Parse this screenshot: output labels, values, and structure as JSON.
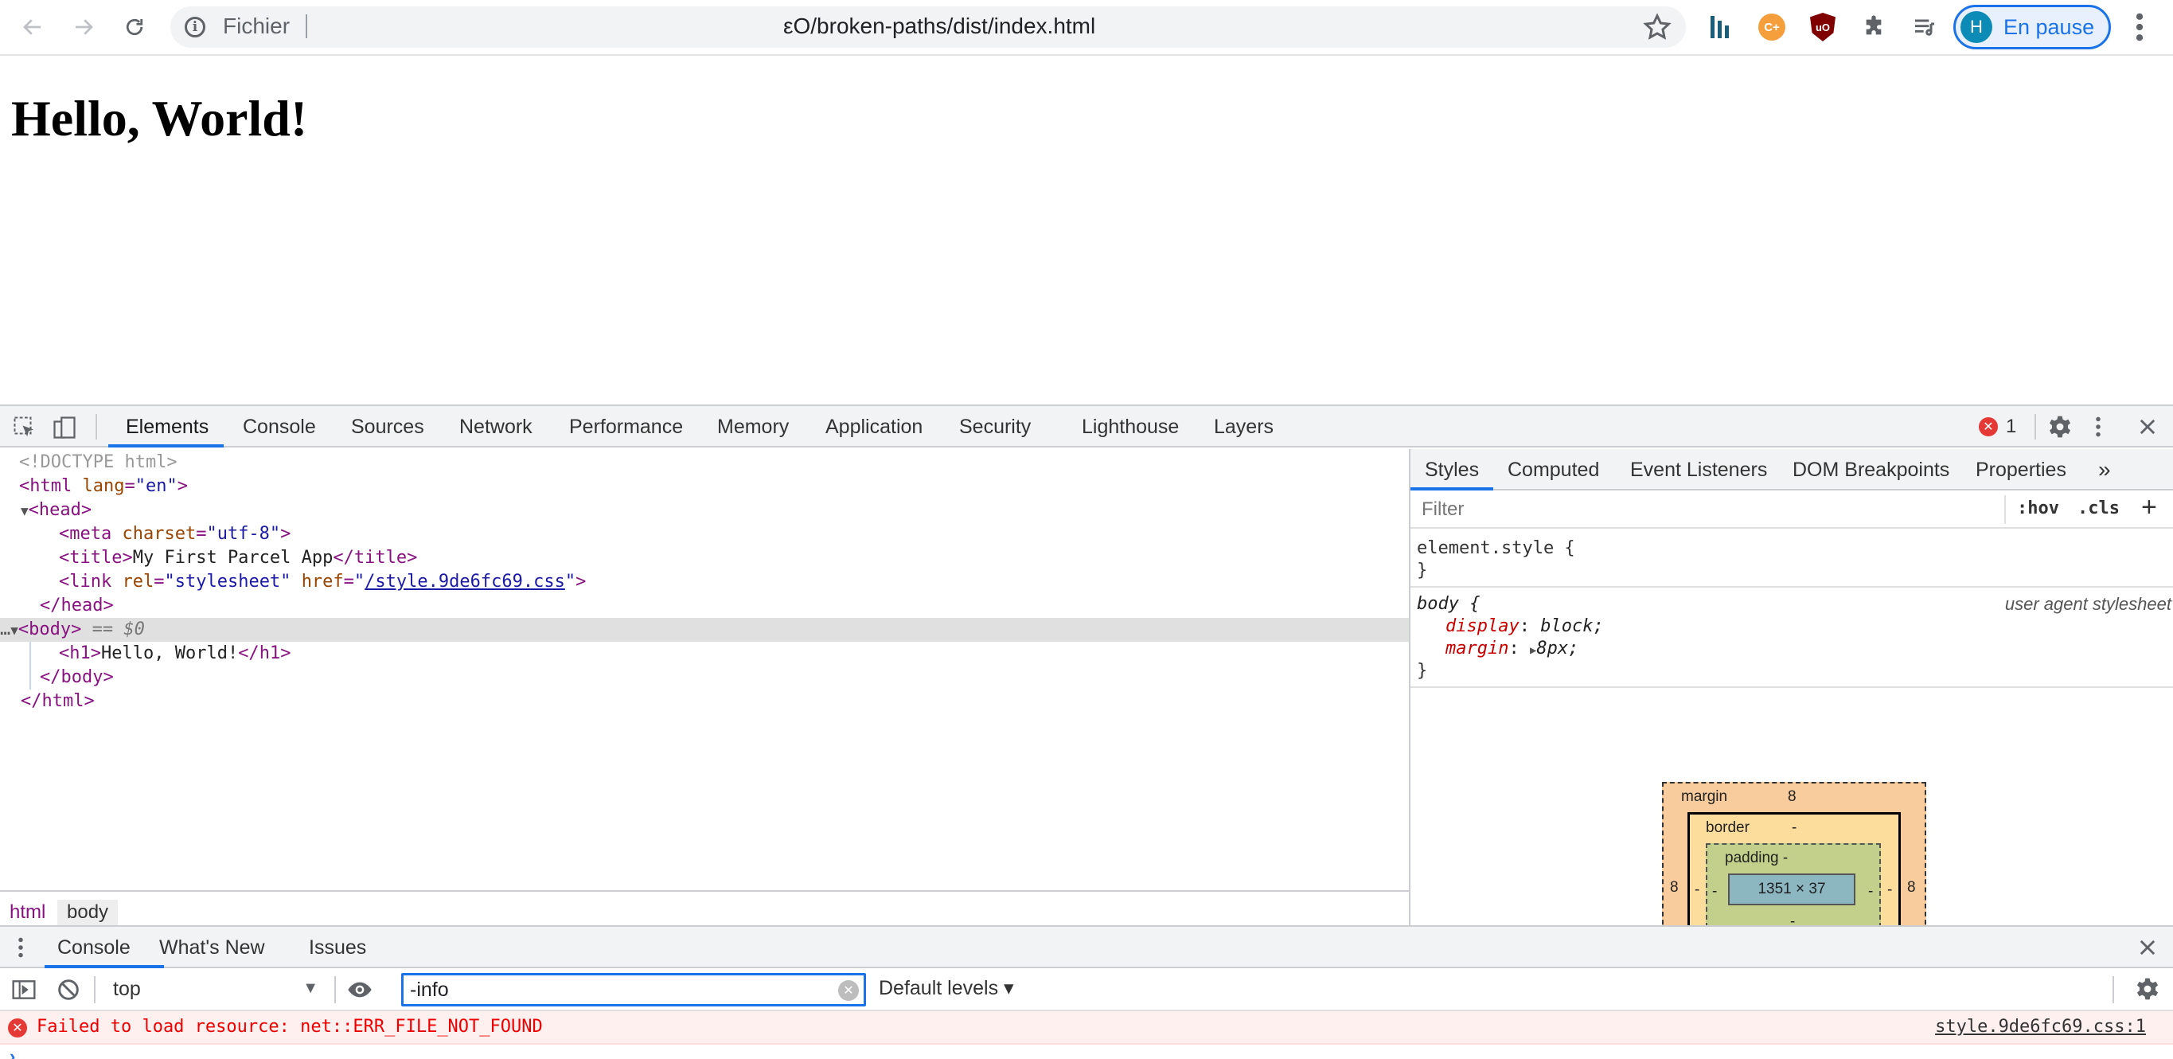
{
  "browser": {
    "scheme_label": "Fichier",
    "url": "εO/broken-paths/dist/index.html",
    "profile_initial": "H",
    "profile_label": "En pause",
    "ext_cplus_label": "C+",
    "ext_ublock_label": "uO"
  },
  "page": {
    "heading": "Hello, World!"
  },
  "devtools": {
    "tabs": [
      "Elements",
      "Console",
      "Sources",
      "Network",
      "Performance",
      "Memory",
      "Application",
      "Security",
      "Lighthouse",
      "Layers"
    ],
    "error_count": "1",
    "dom": {
      "doctype": "<!DOCTYPE html>",
      "html_open": "html",
      "lang_attr": "lang",
      "lang_val": "\"en\"",
      "head": "head",
      "meta": "meta",
      "charset_attr": "charset",
      "charset_val": "\"utf-8\"",
      "title_tag": "title",
      "title_text": "My First Parcel App",
      "link_tag": "link",
      "rel_attr": "rel",
      "rel_val": "\"stylesheet\"",
      "href_attr": "href",
      "href_val": "/style.9de6fc69.css",
      "body": "body",
      "selected_marker": "== $0",
      "h1_tag": "h1",
      "h1_text": "Hello, World!"
    },
    "breadcrumbs": [
      "html",
      "body"
    ],
    "styles_tabs": [
      "Styles",
      "Computed",
      "Event Listeners",
      "DOM Breakpoints",
      "Properties"
    ],
    "styles_more": "»",
    "filter_placeholder": "Filter",
    "hov_label": ":hov",
    "cls_label": ".cls",
    "element_style": "element.style {",
    "close_brace": "}",
    "body_rule": {
      "selector": "body {",
      "source": "user agent stylesheet",
      "props": [
        {
          "name": "display",
          "value": "block;"
        },
        {
          "name": "margin",
          "value": "8px;"
        }
      ]
    },
    "box_model": {
      "margin_label": "margin",
      "margin_top": "8",
      "margin_left": "8",
      "margin_right": "8",
      "border_label": "border",
      "border_top": "-",
      "border_bottom": "-",
      "border_left": "-",
      "border_right": "-",
      "padding_label": "padding -",
      "padding_bottom": "-",
      "padding_left": "-",
      "padding_right": "-",
      "content": "1351 × 37",
      "margin_bottom": "-"
    }
  },
  "drawer": {
    "tabs": [
      "Console",
      "What's New",
      "Issues"
    ],
    "context": "top",
    "filter_value": "-info",
    "levels": "Default levels ▾",
    "error_message": "Failed to load resource: net::ERR_FILE_NOT_FOUND",
    "error_source": "style.9de6fc69.css:1"
  }
}
